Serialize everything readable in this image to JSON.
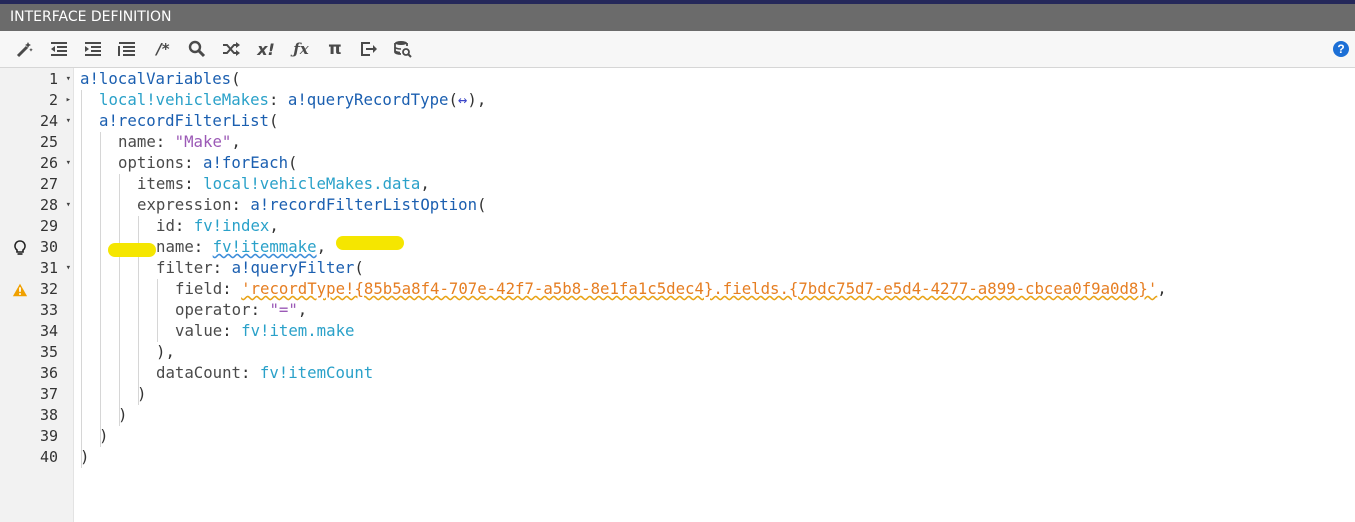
{
  "header": {
    "title": "INTERFACE DEFINITION"
  },
  "toolbar": {
    "icons": [
      "magic-wand-icon",
      "outdent-icon",
      "indent-icon",
      "list-icon",
      "comment-icon",
      "search-icon",
      "shuffle-icon",
      "x-bang-icon",
      "fx-icon",
      "pi-icon",
      "export-icon",
      "database-search-icon"
    ],
    "help_label": "?"
  },
  "gutter": {
    "lines": [
      {
        "num": "1",
        "fold": "▾"
      },
      {
        "num": "2",
        "fold": "▸"
      },
      {
        "num": "24",
        "fold": "▾"
      },
      {
        "num": "25",
        "fold": ""
      },
      {
        "num": "26",
        "fold": "▾"
      },
      {
        "num": "27",
        "fold": ""
      },
      {
        "num": "28",
        "fold": "▾"
      },
      {
        "num": "29",
        "fold": ""
      },
      {
        "num": "30",
        "fold": ""
      },
      {
        "num": "31",
        "fold": "▾"
      },
      {
        "num": "32",
        "fold": ""
      },
      {
        "num": "33",
        "fold": ""
      },
      {
        "num": "34",
        "fold": ""
      },
      {
        "num": "35",
        "fold": ""
      },
      {
        "num": "36",
        "fold": ""
      },
      {
        "num": "37",
        "fold": ""
      },
      {
        "num": "38",
        "fold": ""
      },
      {
        "num": "39",
        "fold": ""
      },
      {
        "num": "40",
        "fold": ""
      }
    ],
    "markers": {
      "line30": "lightbulb-icon",
      "line32": "warning-icon"
    }
  },
  "code": {
    "l1": {
      "fn": "a!localVariables",
      "p": "("
    },
    "l2": {
      "var": "local!vehicleMakes",
      "p1": ": ",
      "fn": "a!queryRecordType",
      "p2": "(",
      "swap": "↔",
      "p3": "),"
    },
    "l24": {
      "fn": "a!recordFilterList",
      "p": "("
    },
    "l25": {
      "key": "name",
      "p1": ": ",
      "str": "\"Make\"",
      "p2": ","
    },
    "l26": {
      "key": "options",
      "p1": ": ",
      "fn": "a!forEach",
      "p2": "("
    },
    "l27": {
      "key": "items",
      "p1": ": ",
      "var": "local!vehicleMakes.data",
      "p2": ","
    },
    "l28": {
      "key": "expression",
      "p1": ": ",
      "fn": "a!recordFilterListOption",
      "p2": "("
    },
    "l29": {
      "key": "id",
      "p1": ": ",
      "var": "fv!index",
      "p2": ","
    },
    "l30": {
      "key": "name",
      "p1": ": ",
      "var": "fv!itemmake",
      "p2": ","
    },
    "l31": {
      "key": "filter",
      "p1": ": ",
      "fn": "a!queryFilter",
      "p2": "("
    },
    "l32": {
      "key": "field",
      "p1": ": ",
      "str": "'recordType!{85b5a8f4-707e-42f7-a5b8-8e1fa1c5dec4}.fields.{7bdc75d7-e5d4-4277-a899-cbcea0f9a0d8}'",
      "p2": ","
    },
    "l33": {
      "key": "operator",
      "p1": ": ",
      "str": "\"=\"",
      "p2": ","
    },
    "l34": {
      "key": "value",
      "p1": ": ",
      "var": "fv!item.make"
    },
    "l35": {
      "p": "),"
    },
    "l36": {
      "key": "dataCount",
      "p1": ": ",
      "var": "fv!itemCount"
    },
    "l37": {
      "p": ")"
    },
    "l38": {
      "p": ")"
    },
    "l39": {
      "p": ")"
    },
    "l40": {
      "p": ")"
    }
  },
  "highlight_color": "#f5e600"
}
